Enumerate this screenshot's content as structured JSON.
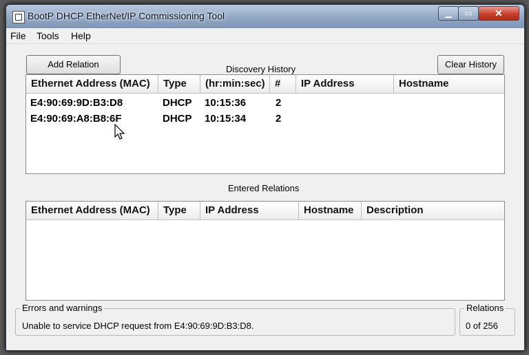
{
  "window": {
    "title": "BootP DHCP EtherNet/IP Commissioning Tool"
  },
  "menu": [
    "File",
    "Tools",
    "Help"
  ],
  "toolbar": {
    "add_relation": "Add Relation",
    "clear_history": "Clear History"
  },
  "discovery": {
    "title": "Discovery History",
    "columns": [
      "Ethernet Address (MAC)",
      "Type",
      "(hr:min:sec)",
      "#",
      "IP Address",
      "Hostname"
    ],
    "rows": [
      [
        "E4:90:69:9D:B3:D8",
        "DHCP",
        "10:15:36",
        "2",
        "",
        ""
      ],
      [
        "E4:90:69:A8:B8:6F",
        "DHCP",
        "10:15:34",
        "2",
        "",
        ""
      ]
    ]
  },
  "relations": {
    "title": "Entered Relations",
    "columns": [
      "Ethernet Address (MAC)",
      "Type",
      "IP Address",
      "Hostname",
      "Description"
    ]
  },
  "status": {
    "errors_label": "Errors and warnings",
    "errors_text": "Unable to service DHCP request from E4:90:69:9D:B3:D8.",
    "relations_label": "Relations",
    "relations_count": "0 of 256"
  }
}
